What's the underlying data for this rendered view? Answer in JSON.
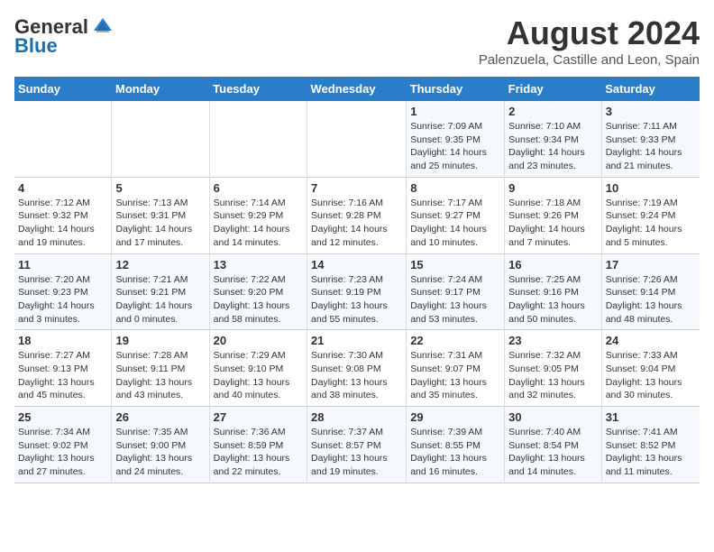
{
  "header": {
    "logo_general": "General",
    "logo_blue": "Blue",
    "month_year": "August 2024",
    "location": "Palenzuela, Castille and Leon, Spain"
  },
  "weekdays": [
    "Sunday",
    "Monday",
    "Tuesday",
    "Wednesday",
    "Thursday",
    "Friday",
    "Saturday"
  ],
  "weeks": [
    [
      {
        "day": "",
        "info": ""
      },
      {
        "day": "",
        "info": ""
      },
      {
        "day": "",
        "info": ""
      },
      {
        "day": "",
        "info": ""
      },
      {
        "day": "1",
        "info": "Sunrise: 7:09 AM\nSunset: 9:35 PM\nDaylight: 14 hours and 25 minutes."
      },
      {
        "day": "2",
        "info": "Sunrise: 7:10 AM\nSunset: 9:34 PM\nDaylight: 14 hours and 23 minutes."
      },
      {
        "day": "3",
        "info": "Sunrise: 7:11 AM\nSunset: 9:33 PM\nDaylight: 14 hours and 21 minutes."
      }
    ],
    [
      {
        "day": "4",
        "info": "Sunrise: 7:12 AM\nSunset: 9:32 PM\nDaylight: 14 hours and 19 minutes."
      },
      {
        "day": "5",
        "info": "Sunrise: 7:13 AM\nSunset: 9:31 PM\nDaylight: 14 hours and 17 minutes."
      },
      {
        "day": "6",
        "info": "Sunrise: 7:14 AM\nSunset: 9:29 PM\nDaylight: 14 hours and 14 minutes."
      },
      {
        "day": "7",
        "info": "Sunrise: 7:16 AM\nSunset: 9:28 PM\nDaylight: 14 hours and 12 minutes."
      },
      {
        "day": "8",
        "info": "Sunrise: 7:17 AM\nSunset: 9:27 PM\nDaylight: 14 hours and 10 minutes."
      },
      {
        "day": "9",
        "info": "Sunrise: 7:18 AM\nSunset: 9:26 PM\nDaylight: 14 hours and 7 minutes."
      },
      {
        "day": "10",
        "info": "Sunrise: 7:19 AM\nSunset: 9:24 PM\nDaylight: 14 hours and 5 minutes."
      }
    ],
    [
      {
        "day": "11",
        "info": "Sunrise: 7:20 AM\nSunset: 9:23 PM\nDaylight: 14 hours and 3 minutes."
      },
      {
        "day": "12",
        "info": "Sunrise: 7:21 AM\nSunset: 9:21 PM\nDaylight: 14 hours and 0 minutes."
      },
      {
        "day": "13",
        "info": "Sunrise: 7:22 AM\nSunset: 9:20 PM\nDaylight: 13 hours and 58 minutes."
      },
      {
        "day": "14",
        "info": "Sunrise: 7:23 AM\nSunset: 9:19 PM\nDaylight: 13 hours and 55 minutes."
      },
      {
        "day": "15",
        "info": "Sunrise: 7:24 AM\nSunset: 9:17 PM\nDaylight: 13 hours and 53 minutes."
      },
      {
        "day": "16",
        "info": "Sunrise: 7:25 AM\nSunset: 9:16 PM\nDaylight: 13 hours and 50 minutes."
      },
      {
        "day": "17",
        "info": "Sunrise: 7:26 AM\nSunset: 9:14 PM\nDaylight: 13 hours and 48 minutes."
      }
    ],
    [
      {
        "day": "18",
        "info": "Sunrise: 7:27 AM\nSunset: 9:13 PM\nDaylight: 13 hours and 45 minutes."
      },
      {
        "day": "19",
        "info": "Sunrise: 7:28 AM\nSunset: 9:11 PM\nDaylight: 13 hours and 43 minutes."
      },
      {
        "day": "20",
        "info": "Sunrise: 7:29 AM\nSunset: 9:10 PM\nDaylight: 13 hours and 40 minutes."
      },
      {
        "day": "21",
        "info": "Sunrise: 7:30 AM\nSunset: 9:08 PM\nDaylight: 13 hours and 38 minutes."
      },
      {
        "day": "22",
        "info": "Sunrise: 7:31 AM\nSunset: 9:07 PM\nDaylight: 13 hours and 35 minutes."
      },
      {
        "day": "23",
        "info": "Sunrise: 7:32 AM\nSunset: 9:05 PM\nDaylight: 13 hours and 32 minutes."
      },
      {
        "day": "24",
        "info": "Sunrise: 7:33 AM\nSunset: 9:04 PM\nDaylight: 13 hours and 30 minutes."
      }
    ],
    [
      {
        "day": "25",
        "info": "Sunrise: 7:34 AM\nSunset: 9:02 PM\nDaylight: 13 hours and 27 minutes."
      },
      {
        "day": "26",
        "info": "Sunrise: 7:35 AM\nSunset: 9:00 PM\nDaylight: 13 hours and 24 minutes."
      },
      {
        "day": "27",
        "info": "Sunrise: 7:36 AM\nSunset: 8:59 PM\nDaylight: 13 hours and 22 minutes."
      },
      {
        "day": "28",
        "info": "Sunrise: 7:37 AM\nSunset: 8:57 PM\nDaylight: 13 hours and 19 minutes."
      },
      {
        "day": "29",
        "info": "Sunrise: 7:39 AM\nSunset: 8:55 PM\nDaylight: 13 hours and 16 minutes."
      },
      {
        "day": "30",
        "info": "Sunrise: 7:40 AM\nSunset: 8:54 PM\nDaylight: 13 hours and 14 minutes."
      },
      {
        "day": "31",
        "info": "Sunrise: 7:41 AM\nSunset: 8:52 PM\nDaylight: 13 hours and 11 minutes."
      }
    ]
  ]
}
